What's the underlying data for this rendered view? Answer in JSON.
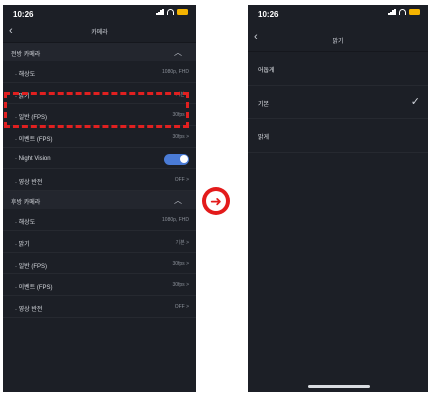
{
  "left_screen": {
    "status_time": "10:26",
    "title": "카메라",
    "front_section": "전방 카메라",
    "front_rows": [
      {
        "label": "· 해상도",
        "value": "1080p, FHD"
      },
      {
        "label": "· 밝기",
        "value": "기본 >"
      },
      {
        "label": "· 일반 (FPS)",
        "value": "30fps >"
      },
      {
        "label": "· 이벤트 (FPS)",
        "value": "30fps >"
      },
      {
        "label": "· Night Vision",
        "value": "",
        "toggle": true
      },
      {
        "label": "· 영상 반전",
        "value": "OFF >"
      }
    ],
    "rear_section": "후방 카메라",
    "rear_rows": [
      {
        "label": "· 해상도",
        "value": "1080p, FHD"
      },
      {
        "label": "· 밝기",
        "value": "기본 >"
      },
      {
        "label": "· 일반 (FPS)",
        "value": "30fps >"
      },
      {
        "label": "· 이벤트 (FPS)",
        "value": "30fps >"
      },
      {
        "label": "· 영상 반전",
        "value": "OFF >"
      }
    ]
  },
  "right_screen": {
    "status_time": "10:26",
    "title": "밝기",
    "options": [
      {
        "label": "어둡게",
        "selected": false
      },
      {
        "label": "기본",
        "selected": true
      },
      {
        "label": "밝게",
        "selected": false
      }
    ]
  },
  "colors": {
    "background": "#1c1f26",
    "accent": "#4a7bd6",
    "highlight": "#e02020",
    "arrow": "#e31b1b"
  }
}
